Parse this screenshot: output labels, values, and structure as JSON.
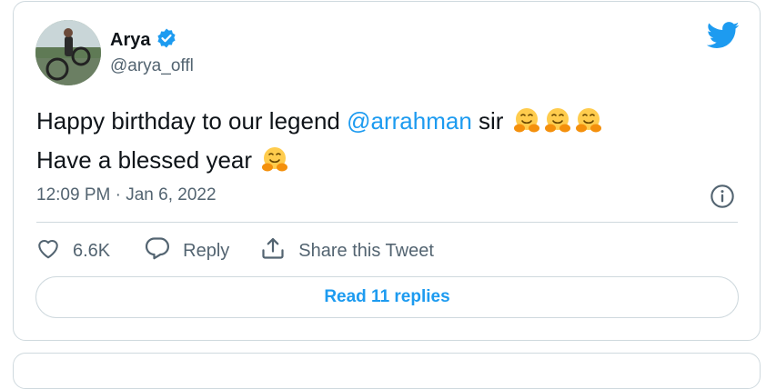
{
  "author": {
    "name": "Arya",
    "handle": "@arya_offl",
    "verified": true
  },
  "tweet": {
    "text_part1": "Happy birthday to our legend ",
    "mention": "@arrahman",
    "text_part2": " sir",
    "line2": "Have a blessed year",
    "emoji": "hugging-face"
  },
  "timestamp": "12:09 PM · Jan 6, 2022",
  "actions": {
    "likes": "6.6K",
    "reply_label": "Reply",
    "share_label": "Share this Tweet"
  },
  "replies_button": "Read 11 replies",
  "colors": {
    "accent": "#1d9bf0",
    "muted": "#536471",
    "border": "#cfd9de",
    "text": "#0f1419"
  },
  "icons": [
    "twitter-bird-icon",
    "verified-badge-icon",
    "info-icon",
    "heart-icon",
    "reply-icon",
    "share-icon"
  ]
}
